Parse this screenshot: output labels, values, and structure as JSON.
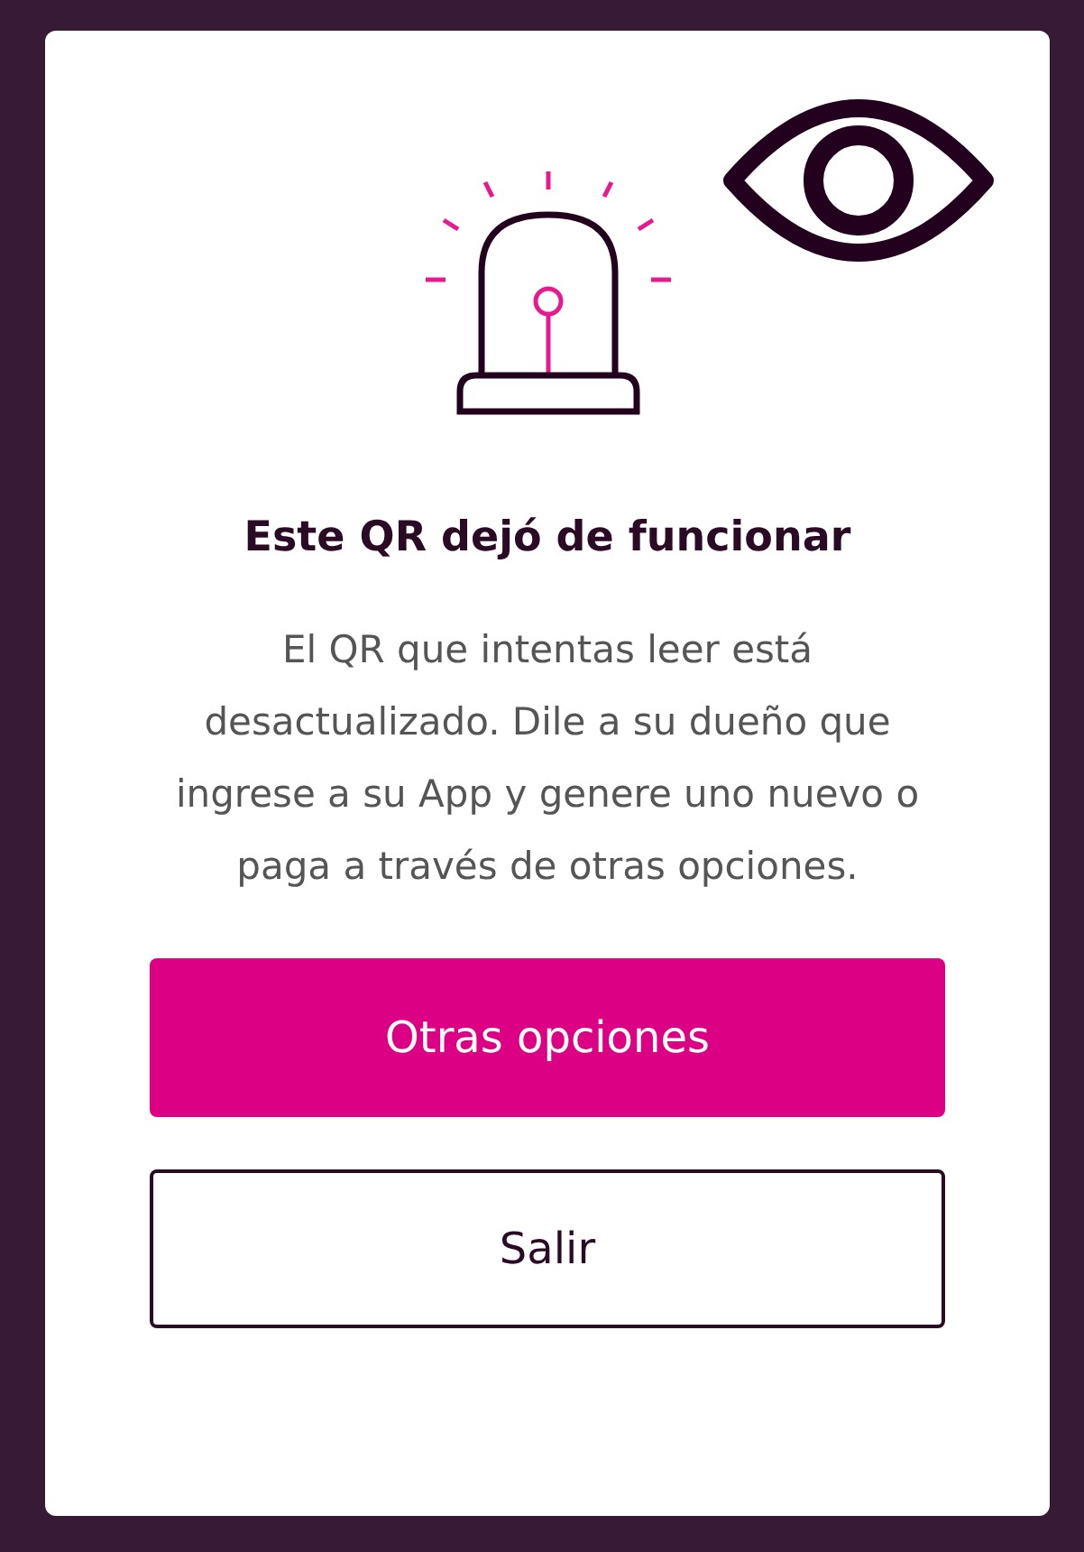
{
  "dialog": {
    "title": "Este QR dejó de funcionar",
    "message": "El QR que intentas leer está desactualizado. Dile a su dueño que ingrese a su App y genere uno nuevo o paga a través de otras opciones.",
    "buttons": [
      {
        "label": "Otras opciones",
        "kind": "primary"
      },
      {
        "label": "Salir",
        "kind": "outline"
      }
    ]
  }
}
